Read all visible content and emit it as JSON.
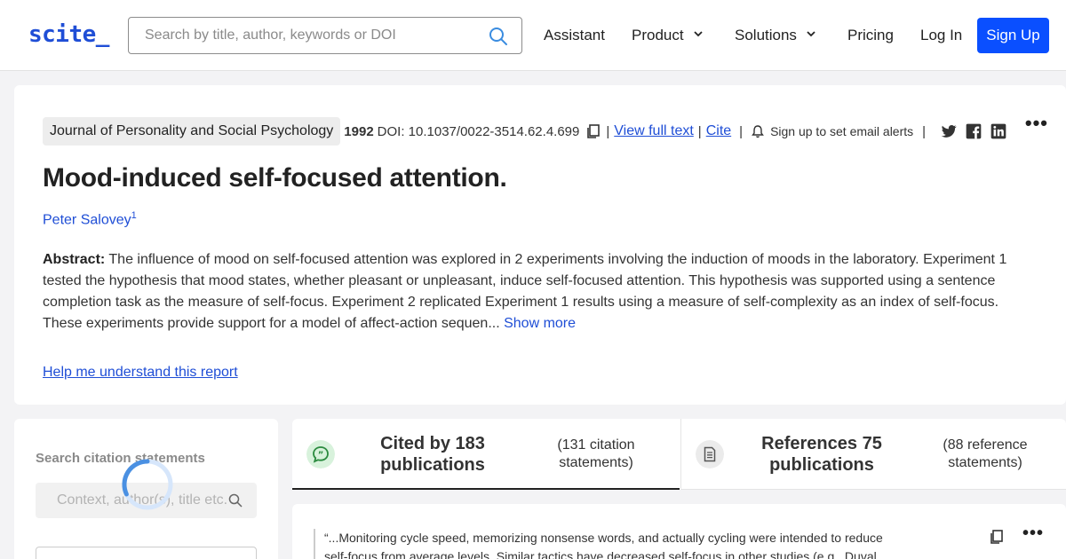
{
  "header": {
    "logo": "scite_",
    "search_placeholder": "Search by title, author, keywords or DOI",
    "nav": {
      "assistant": "Assistant",
      "product": "Product",
      "solutions": "Solutions",
      "pricing": "Pricing",
      "login": "Log In",
      "signup": "Sign Up"
    }
  },
  "paper": {
    "journal": "Journal of Personality and Social Psychology",
    "year": "1992",
    "doi": "DOI: 10.1037/0022-3514.62.4.699",
    "view_full_text": "View full text",
    "cite": "Cite",
    "alerts": "Sign up to set email alerts",
    "title": "Mood-induced self-focused attention.",
    "author": "Peter Salovey",
    "author_sup": "1",
    "abstract_label": "Abstract:",
    "abstract_text": "The influence of mood on self-focused attention was explored in 2 experiments involving the induction of moods in the laboratory. Experiment 1 tested the hypothesis that mood states, whether pleasant or unpleasant, induce self-focused attention. This hypothesis was supported using a sentence completion task as the measure of self-focus. Experiment 2 replicated Experiment 1 results using a measure of self-complexity as an index of self-focus. These experiments provide support for a model of affect-action sequen...",
    "show_more": "Show more",
    "help_link": "Help me understand this report"
  },
  "left_panel": {
    "title": "Search citation statements",
    "search_placeholder": "Context, author(s), title etc."
  },
  "tabs": {
    "cited": {
      "main": "Cited by 183 publications",
      "sub": "(131 citation statements)"
    },
    "references": {
      "main": "References 75 publications",
      "sub": "(88 reference statements)"
    }
  },
  "statement": {
    "quote": "“...Monitoring cycle speed, memorizing nonsense words, and actually cycling were intended to reduce self-focus from average levels. Similar tactics have decreased self-focus in other studies (e.g., Duval &"
  },
  "colors": {
    "brand": "#1f4ed6",
    "signup_bg": "#0a4fff",
    "cited_icon_bg": "#d8f2dc",
    "cited_icon_fg": "#2a8a3e"
  },
  "icons": [
    "search-icon",
    "chevron-down-icon",
    "copy-icon",
    "bell-icon",
    "twitter-icon",
    "facebook-icon",
    "linkedin-icon",
    "more-icon",
    "chat-quote-icon",
    "document-icon",
    "loading-spinner"
  ]
}
